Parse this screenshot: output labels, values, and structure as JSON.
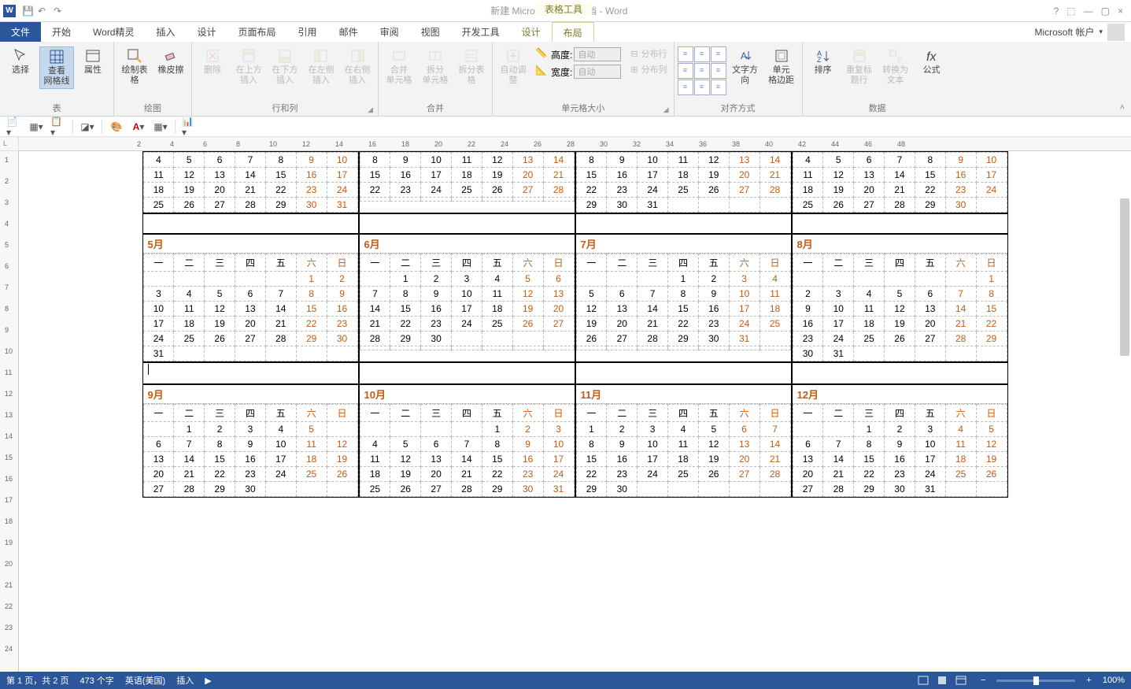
{
  "title_bar": {
    "app_icon": "W",
    "document_title": "新建 Microsoft Word 文档 - Word",
    "contextual_label": "表格工具",
    "help_icon": "?",
    "min_icon": "—",
    "max_icon": "▢",
    "close_icon": "×",
    "ribbon_display_icon": "⬚"
  },
  "tabs": {
    "file": "文件",
    "items": [
      "开始",
      "Word精灵",
      "插入",
      "设计",
      "页面布局",
      "引用",
      "邮件",
      "审阅",
      "视图",
      "开发工具"
    ],
    "contextual": [
      "设计",
      "布局"
    ],
    "active": "布局",
    "account": "Microsoft 帐户"
  },
  "ribbon": {
    "table_group": {
      "label": "表",
      "select": "选择",
      "view_gridlines": "查看\n网格线",
      "properties": "属性"
    },
    "draw_group": {
      "label": "绘图",
      "draw_table": "绘制表格",
      "eraser": "橡皮擦"
    },
    "rows_cols_group": {
      "label": "行和列",
      "delete": "删除",
      "insert_above": "在上方插入",
      "insert_below": "在下方插入",
      "insert_left": "在左侧插入",
      "insert_right": "在右侧插入"
    },
    "merge_group": {
      "label": "合并",
      "merge_cells": "合并\n单元格",
      "split_cells": "拆分\n单元格",
      "split_table": "拆分表格"
    },
    "cell_size_group": {
      "label": "单元格大小",
      "autofit": "自动调整",
      "height_label": "高度:",
      "width_label": "宽度:",
      "height_value": "自动",
      "width_value": "自动",
      "distribute_rows": "分布行",
      "distribute_cols": "分布列"
    },
    "alignment_group": {
      "label": "对齐方式",
      "text_direction": "文字方向",
      "cell_margins": "单元\n格边距"
    },
    "data_group": {
      "label": "数据",
      "sort": "排序",
      "repeat_header": "重复标题行",
      "convert_to_text": "转换为文本",
      "formula": "公式"
    }
  },
  "sec_toolbar": {
    "icons": [
      "new-doc",
      "table",
      "clipboard",
      "divider",
      "shape",
      "divider",
      "palette",
      "font-color",
      "grid",
      "divider",
      "insert-symbol"
    ]
  },
  "ruler": {
    "h_ticks": [
      2,
      4,
      6,
      8,
      10,
      12,
      14,
      16,
      18,
      20,
      22,
      24,
      26,
      28,
      30,
      32,
      34,
      36,
      38,
      40,
      42,
      44,
      46,
      48
    ],
    "v_ticks": [
      1,
      2,
      3,
      4,
      5,
      6,
      7,
      8,
      9,
      10,
      11,
      12,
      13,
      14,
      15,
      16,
      17,
      18,
      19,
      20,
      21,
      22,
      23,
      24
    ]
  },
  "calendar": {
    "weekday_header": [
      "一",
      "二",
      "三",
      "四",
      "五",
      "六",
      "日"
    ],
    "partial_top": [
      {
        "rows": [
          [
            "4",
            "5",
            "6",
            "7",
            "8",
            "9",
            "10"
          ],
          [
            "11",
            "12",
            "13",
            "14",
            "15",
            "16",
            "17"
          ],
          [
            "18",
            "19",
            "20",
            "21",
            "22",
            "23",
            "24"
          ],
          [
            "25",
            "26",
            "27",
            "28",
            "29",
            "30",
            "31"
          ]
        ]
      },
      {
        "rows": [
          [
            "8",
            "9",
            "10",
            "11",
            "12",
            "13",
            "14"
          ],
          [
            "15",
            "16",
            "17",
            "18",
            "19",
            "20",
            "21"
          ],
          [
            "22",
            "23",
            "24",
            "25",
            "26",
            "27",
            "28"
          ],
          [
            "",
            "",
            "",
            "",
            "",
            "",
            ""
          ]
        ]
      },
      {
        "rows": [
          [
            "8",
            "9",
            "10",
            "11",
            "12",
            "13",
            "14"
          ],
          [
            "15",
            "16",
            "17",
            "18",
            "19",
            "20",
            "21"
          ],
          [
            "22",
            "23",
            "24",
            "25",
            "26",
            "27",
            "28"
          ],
          [
            "29",
            "30",
            "31",
            "",
            "",
            "",
            ""
          ]
        ]
      },
      {
        "rows": [
          [
            "4",
            "5",
            "6",
            "7",
            "8",
            "9",
            "10"
          ],
          [
            "11",
            "12",
            "13",
            "14",
            "15",
            "16",
            "17"
          ],
          [
            "18",
            "19",
            "20",
            "21",
            "22",
            "23",
            "24"
          ],
          [
            "25",
            "26",
            "27",
            "28",
            "29",
            "30",
            ""
          ]
        ]
      }
    ],
    "months_row2_titles": [
      "5月",
      "6月",
      "7月",
      "8月"
    ],
    "months_row2": [
      {
        "first": [
          "",
          "",
          "",
          "",
          "",
          "1",
          "2"
        ],
        "rows": [
          [
            "3",
            "4",
            "5",
            "6",
            "7",
            "8",
            "9"
          ],
          [
            "10",
            "11",
            "12",
            "13",
            "14",
            "15",
            "16"
          ],
          [
            "17",
            "18",
            "19",
            "20",
            "21",
            "22",
            "23"
          ],
          [
            "24",
            "25",
            "26",
            "27",
            "28",
            "29",
            "30"
          ],
          [
            "31",
            "",
            "",
            "",
            "",
            "",
            ""
          ]
        ]
      },
      {
        "first": [
          "",
          "1",
          "2",
          "3",
          "4",
          "5",
          "6"
        ],
        "rows": [
          [
            "7",
            "8",
            "9",
            "10",
            "11",
            "12",
            "13"
          ],
          [
            "14",
            "15",
            "16",
            "17",
            "18",
            "19",
            "20"
          ],
          [
            "21",
            "22",
            "23",
            "24",
            "25",
            "26",
            "27"
          ],
          [
            "28",
            "29",
            "30",
            "",
            "",
            "",
            ""
          ],
          [
            "",
            "",
            "",
            "",
            "",
            "",
            ""
          ]
        ]
      },
      {
        "first": [
          "",
          "",
          "",
          "1",
          "2",
          "3",
          "4"
        ],
        "rows": [
          [
            "5",
            "6",
            "7",
            "8",
            "9",
            "10",
            "11"
          ],
          [
            "12",
            "13",
            "14",
            "15",
            "16",
            "17",
            "18"
          ],
          [
            "19",
            "20",
            "21",
            "22",
            "23",
            "24",
            "25"
          ],
          [
            "26",
            "27",
            "28",
            "29",
            "30",
            "31",
            ""
          ],
          [
            "",
            "",
            "",
            "",
            "",
            "",
            ""
          ]
        ]
      },
      {
        "first": [
          "",
          "",
          "",
          "",
          "",
          "",
          "1"
        ],
        "rows": [
          [
            "2",
            "3",
            "4",
            "5",
            "6",
            "7",
            "8"
          ],
          [
            "9",
            "10",
            "11",
            "12",
            "13",
            "14",
            "15"
          ],
          [
            "16",
            "17",
            "18",
            "19",
            "20",
            "21",
            "22"
          ],
          [
            "23",
            "24",
            "25",
            "26",
            "27",
            "28",
            "29"
          ],
          [
            "30",
            "31",
            "",
            "",
            "",
            "",
            ""
          ]
        ]
      }
    ],
    "months_row3_titles": [
      "9月",
      "10月",
      "11月",
      "12月"
    ],
    "months_row3": [
      {
        "first": [
          "",
          "1",
          "2",
          "3",
          "4",
          "5",
          ""
        ],
        "rows": [
          [
            "6",
            "7",
            "8",
            "9",
            "10",
            "11",
            "12"
          ],
          [
            "13",
            "14",
            "15",
            "16",
            "17",
            "18",
            "19"
          ],
          [
            "20",
            "21",
            "22",
            "23",
            "24",
            "25",
            "26"
          ],
          [
            "27",
            "28",
            "29",
            "30",
            "",
            "",
            ""
          ]
        ]
      },
      {
        "first": [
          "",
          "",
          "",
          "",
          "1",
          "2",
          "3"
        ],
        "rows": [
          [
            "4",
            "5",
            "6",
            "7",
            "8",
            "9",
            "10"
          ],
          [
            "11",
            "12",
            "13",
            "14",
            "15",
            "16",
            "17"
          ],
          [
            "18",
            "19",
            "20",
            "21",
            "22",
            "23",
            "24"
          ],
          [
            "25",
            "26",
            "27",
            "28",
            "29",
            "30",
            "31"
          ]
        ]
      },
      {
        "first": [
          "1",
          "2",
          "3",
          "4",
          "5",
          "6",
          "7"
        ],
        "rows": [
          [
            "8",
            "9",
            "10",
            "11",
            "12",
            "13",
            "14"
          ],
          [
            "15",
            "16",
            "17",
            "18",
            "19",
            "20",
            "21"
          ],
          [
            "22",
            "23",
            "24",
            "25",
            "26",
            "27",
            "28"
          ],
          [
            "29",
            "30",
            "",
            "",
            "",
            "",
            ""
          ]
        ]
      },
      {
        "first": [
          "",
          "",
          "1",
          "2",
          "3",
          "4",
          "5"
        ],
        "rows": [
          [
            "6",
            "7",
            "8",
            "9",
            "10",
            "11",
            "12"
          ],
          [
            "13",
            "14",
            "15",
            "16",
            "17",
            "18",
            "19"
          ],
          [
            "20",
            "21",
            "22",
            "23",
            "24",
            "25",
            "26"
          ],
          [
            "27",
            "28",
            "29",
            "30",
            "31",
            "",
            ""
          ]
        ]
      }
    ]
  },
  "status_bar": {
    "page": "第 1 页，共 2 页",
    "words": "473 个字",
    "language": "英语(美国)",
    "insert_mode": "插入",
    "zoom_minus": "−",
    "zoom_plus": "+",
    "zoom_value": "100%"
  }
}
